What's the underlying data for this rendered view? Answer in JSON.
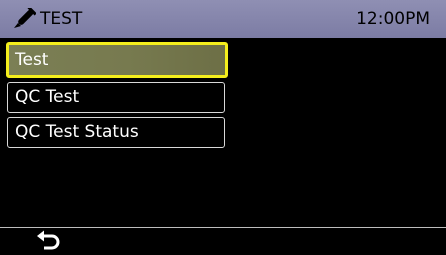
{
  "header": {
    "icon": "test-tube-icon",
    "title": "TEST",
    "clock": "12:00PM",
    "background_color": "#8585ac"
  },
  "menu": {
    "items": [
      {
        "label": "Test",
        "selected": true
      },
      {
        "label": "QC Test",
        "selected": false
      },
      {
        "label": "QC Test Status",
        "selected": false
      }
    ],
    "selection_highlight_color": "#f4ee1d"
  },
  "footer": {
    "back_icon": "back-arrow-icon"
  }
}
